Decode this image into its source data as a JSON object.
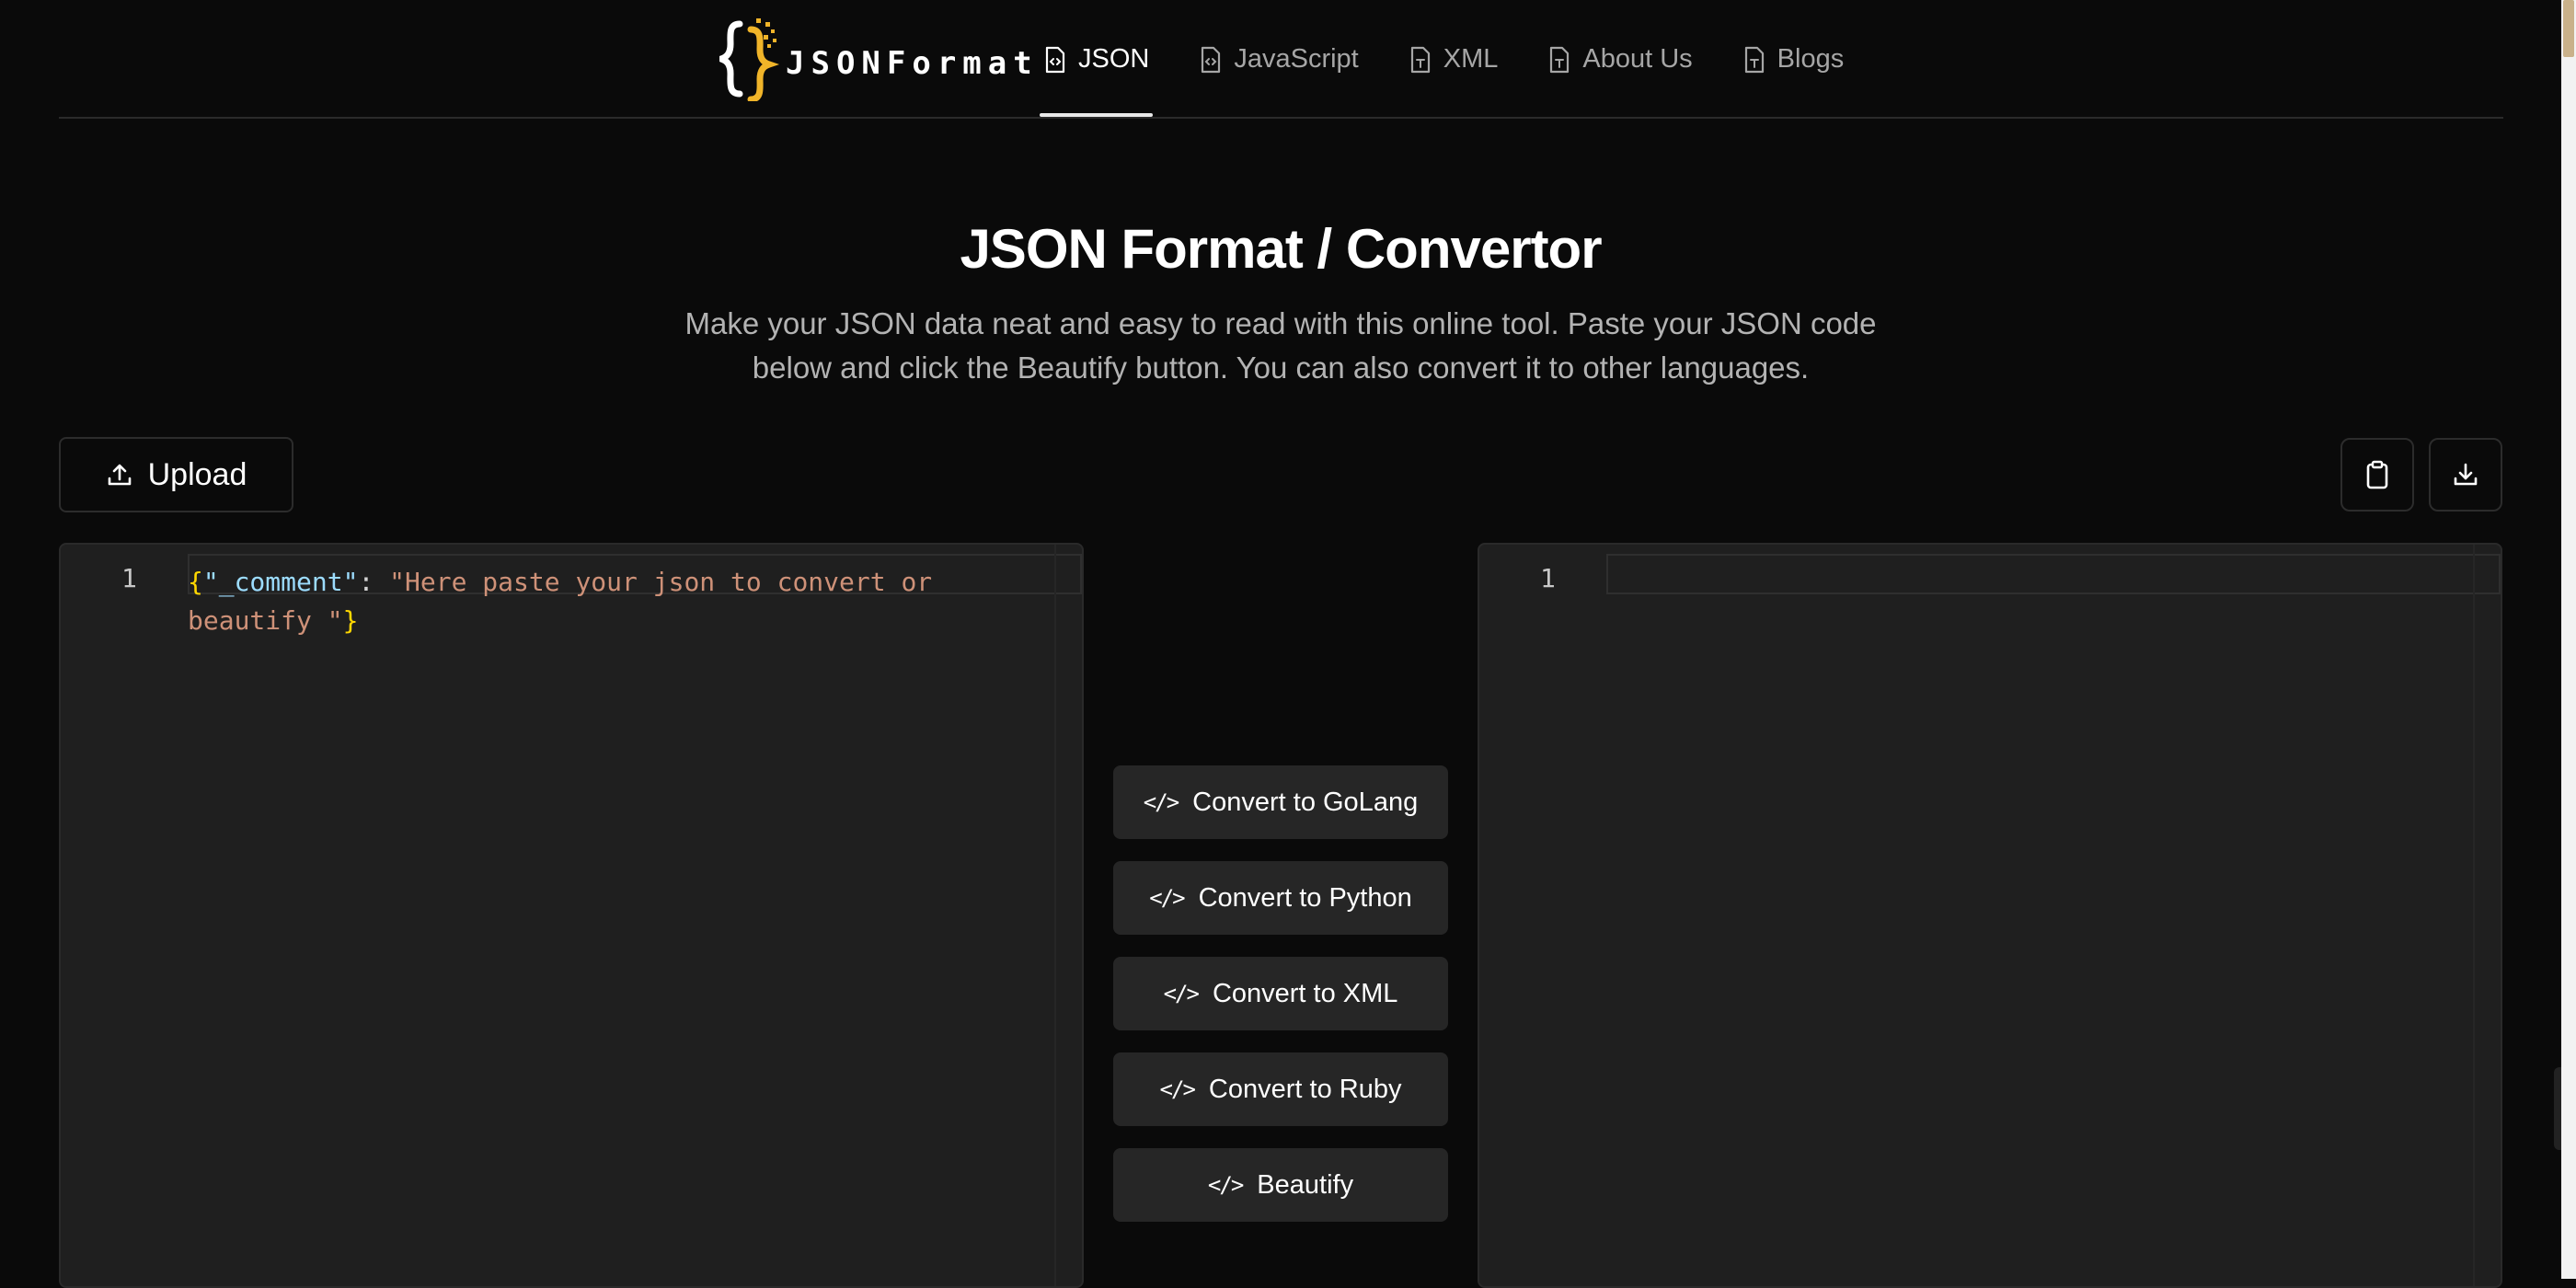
{
  "header": {
    "logo_text": "JSONFormat",
    "nav": [
      {
        "label": "JSON",
        "icon": "file-code-icon",
        "active": true
      },
      {
        "label": "JavaScript",
        "icon": "file-code-icon",
        "active": false
      },
      {
        "label": "XML",
        "icon": "file-text-icon",
        "active": false
      },
      {
        "label": "About Us",
        "icon": "file-icon",
        "active": false
      },
      {
        "label": "Blogs",
        "icon": "file-text-icon",
        "active": false
      }
    ]
  },
  "hero": {
    "title": "JSON Format / Convertor",
    "description": "Make your JSON data neat and easy to read with this online tool. Paste your JSON code below and click the Beautify button. You can also convert it to other languages."
  },
  "toolbar": {
    "upload_label": "Upload",
    "copy_icon": "clipboard-icon",
    "download_icon": "download-icon"
  },
  "input_editor": {
    "line_number": "1",
    "code": {
      "open_brace": "{",
      "key": "\"_comment\"",
      "colon": ": ",
      "value": "\"Here paste your json to convert or beautify \"",
      "close_brace": "}"
    }
  },
  "output_editor": {
    "line_number": "1",
    "code": ""
  },
  "actions": [
    {
      "label": "Convert to GoLang",
      "icon": "code-icon"
    },
    {
      "label": "Convert to Python",
      "icon": "code-icon"
    },
    {
      "label": "Convert to XML",
      "icon": "code-icon"
    },
    {
      "label": "Convert to Ruby",
      "icon": "code-icon"
    },
    {
      "label": "Beautify",
      "icon": "code-icon"
    }
  ],
  "colors": {
    "background": "#0a0a0a",
    "editor_bg": "#1f1f1f",
    "button_bg": "#262626",
    "logo_accent": "#f0b429"
  }
}
